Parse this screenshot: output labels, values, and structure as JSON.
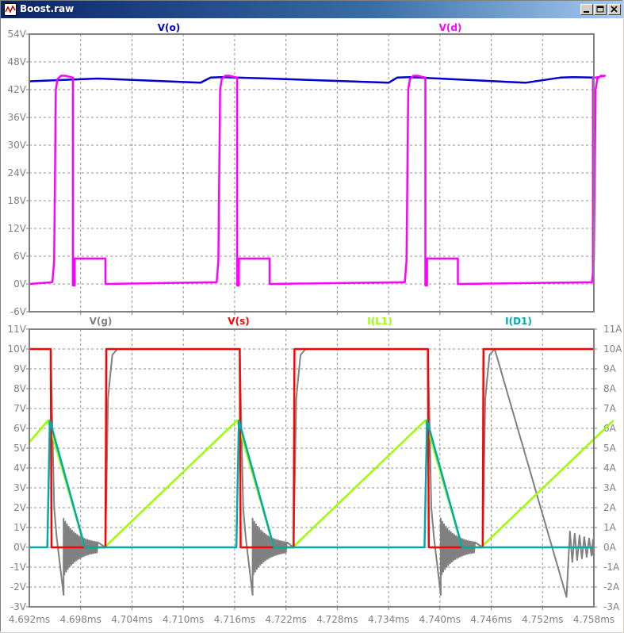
{
  "window": {
    "title": "Boost.raw",
    "icon": "waveform-icon",
    "buttons": [
      "minimize-icon",
      "maximize-icon",
      "close-icon"
    ]
  },
  "chart_data": [
    {
      "type": "line",
      "series": [
        {
          "name": "V(o)",
          "color": "#0000cc",
          "x": [
            4.692,
            4.7,
            4.712,
            4.7132,
            4.7145,
            4.72,
            4.734,
            4.735,
            4.7365,
            4.75,
            4.7541,
            4.7556,
            4.758
          ],
          "y": [
            43.8,
            44.4,
            43.5,
            44.6,
            44.7,
            44.4,
            43.5,
            44.6,
            44.7,
            43.5,
            44.6,
            44.7,
            44.6
          ]
        }
      ],
      "series_b": [
        {
          "name": "V(d)",
          "color": "#ff00ff",
          "x": [
            4.692,
            4.6947,
            4.6949,
            4.6951,
            4.6953,
            4.6957,
            4.6962,
            4.6967,
            4.6971,
            4.6971,
            4.6972,
            4.6979,
            4.6985,
            4.7139,
            4.7141,
            4.7143,
            4.7145,
            4.7149,
            4.7154,
            4.7159,
            4.7163,
            4.7163,
            4.7164,
            4.7171,
            4.7177,
            4.7359,
            4.7361,
            4.7363,
            4.7365,
            4.7369,
            4.7374,
            4.7379,
            4.7383,
            4.7383,
            4.7384,
            4.7391,
            4.7397,
            4.7578,
            4.758,
            4.758
          ],
          "y": [
            0,
            0.5,
            5,
            42,
            44.3,
            45,
            45,
            44.8,
            44.6,
            0,
            -0.4,
            10,
            0,
            0,
            5,
            42,
            44.3,
            45,
            45,
            44.8,
            44.6,
            0,
            -0.4,
            10,
            0,
            0,
            5,
            42,
            44.3,
            45,
            45,
            44.8,
            44.6,
            0,
            -0.4,
            10,
            0,
            0,
            5,
            44
          ],
          "note_x": "ms"
        }
      ],
      "xlim": [
        4.692,
        4.758
      ],
      "ylim": [
        -6,
        54
      ],
      "yticks": [
        "54V",
        "48V",
        "42V",
        "36V",
        "30V",
        "24V",
        "18V",
        "12V",
        "6V",
        "0V",
        "-6V"
      ],
      "grid": true,
      "legend": [
        "V(o)",
        "V(d)"
      ]
    },
    {
      "type": "line",
      "series": [
        {
          "name": "V(g)",
          "color": "#808080"
        },
        {
          "name": "V(s)",
          "color": "#ff0000",
          "x": [
            4.692,
            4.6945,
            4.6946,
            4.7009,
            4.701,
            4.7166,
            4.7167,
            4.7229,
            4.723,
            4.7386,
            4.7387,
            4.745,
            4.7451,
            4.758
          ],
          "y": [
            10,
            10,
            0,
            0,
            10,
            10,
            0,
            0,
            10,
            10,
            0,
            0,
            10,
            10
          ]
        },
        {
          "name": "I(L1)",
          "color": "#99ff00",
          "x": [
            4.692,
            4.6942,
            4.6985,
            4.7008,
            4.7163,
            4.7206,
            4.7228,
            4.7383,
            4.7426,
            4.7448,
            4.7603
          ],
          "y": [
            5.3,
            6.4,
            0,
            0,
            6.4,
            0,
            0,
            6.4,
            0,
            0,
            6.4
          ]
        },
        {
          "name": "I(D1)",
          "color": "#00aaaa",
          "x": [
            4.692,
            4.6941,
            4.6944,
            4.6985,
            4.7162,
            4.7165,
            4.7206,
            4.7382,
            4.7385,
            4.7426,
            4.758
          ],
          "y": [
            0,
            0,
            6.4,
            0,
            0,
            6.4,
            0,
            0,
            6.4,
            0,
            0
          ]
        }
      ],
      "xlim": [
        4.692,
        4.758
      ],
      "ylim": [
        -3,
        11
      ],
      "yticks_left": [
        "11V",
        "10V",
        "9V",
        "8V",
        "7V",
        "6V",
        "5V",
        "4V",
        "3V",
        "2V",
        "1V",
        "0V",
        "-1V",
        "-2V",
        "-3V"
      ],
      "yticks_right": [
        "11A",
        "10A",
        "9A",
        "8A",
        "7A",
        "6A",
        "5A",
        "4A",
        "3A",
        "2A",
        "1A",
        "0A",
        "-1A",
        "-2A",
        "-3A"
      ],
      "xticks": [
        "4.692ms",
        "4.698ms",
        "4.704ms",
        "4.710ms",
        "4.716ms",
        "4.722ms",
        "4.728ms",
        "4.734ms",
        "4.740ms",
        "4.746ms",
        "4.752ms",
        "4.758ms"
      ],
      "grid": true,
      "legend": [
        "V(g)",
        "V(s)",
        "I(L1)",
        "I(D1)"
      ]
    }
  ]
}
